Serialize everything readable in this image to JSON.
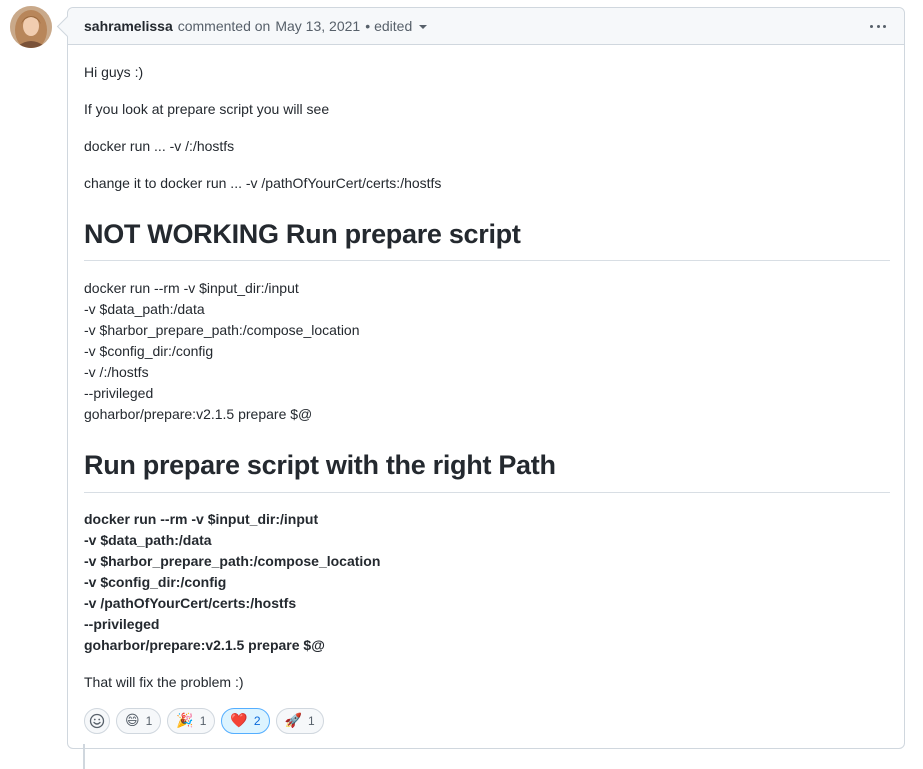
{
  "comment": {
    "author": "sahramelissa",
    "action": "commented on",
    "date": "May 13, 2021",
    "separator": "•",
    "edited_label": "edited"
  },
  "body": {
    "p1": "Hi guys :)",
    "p2": "If you look at prepare script you will see",
    "p3": "docker run ... -v /:/hostfs",
    "p4": "change it to docker run ... -v /pathOfYourCert/certs:/hostfs",
    "heading1": "NOT WORKING Run prepare script",
    "code1": [
      "docker run --rm -v $input_dir:/input",
      "-v $data_path:/data",
      "-v $harbor_prepare_path:/compose_location",
      "-v $config_dir:/config",
      "-v /:/hostfs",
      "--privileged",
      "goharbor/prepare:v2.1.5 prepare $@"
    ],
    "heading2": "Run prepare script with the right Path",
    "code2": [
      "docker run --rm -v $input_dir:/input",
      "-v $data_path:/data",
      "-v $harbor_prepare_path:/compose_location",
      "-v $config_dir:/config",
      "-v /pathOfYourCert/certs:/hostfs",
      "--privileged",
      "goharbor/prepare:v2.1.5 prepare $@"
    ],
    "closing": "That will fix the problem :)"
  },
  "reactions": [
    {
      "emoji": "😄",
      "count": "1",
      "active": false
    },
    {
      "emoji": "🎉",
      "count": "1",
      "active": false
    },
    {
      "emoji": "❤️",
      "count": "2",
      "active": true
    },
    {
      "emoji": "🚀",
      "count": "1",
      "active": false
    }
  ],
  "icons": {
    "add_reaction": "smiley-icon",
    "menu": "kebab-horizontal-icon"
  },
  "colors": {
    "accent": "#0969da",
    "active_bg": "#ddf4ff",
    "border": "#d0d7de"
  }
}
